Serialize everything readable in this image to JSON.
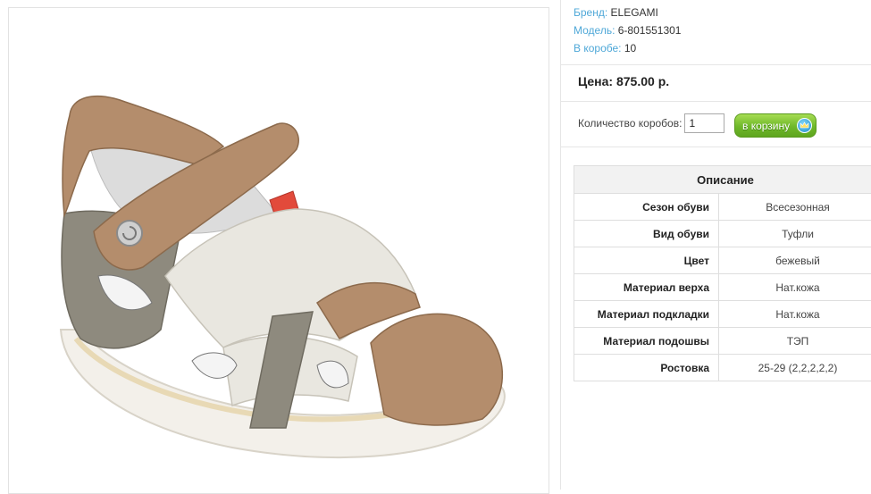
{
  "product": {
    "image_alt": "Детская сандалия ELEGAMI",
    "brand_label": "Бренд:",
    "brand": "ELEGAMI",
    "model_label": "Модель:",
    "model": "6-801551301",
    "box_label": "В коробе:",
    "box_count": "10",
    "price": "Цена: 875.00 р.",
    "qty_label": "Количество коробов:",
    "qty_value": "1",
    "cart_label": "в корзину"
  },
  "specs": {
    "title": "Описание",
    "rows": [
      {
        "key": "Сезон обуви",
        "value": "Всесезонная"
      },
      {
        "key": "Вид обуви",
        "value": "Туфли"
      },
      {
        "key": "Цвет",
        "value": "бежевый"
      },
      {
        "key": "Материал верха",
        "value": "Нат.кожа"
      },
      {
        "key": "Материал подкладки",
        "value": "Нат.кожа"
      },
      {
        "key": "Материал подошвы",
        "value": "ТЭП"
      },
      {
        "key": "Ростовка",
        "value": "25-29 (2,2,2,2,2)"
      }
    ]
  },
  "colors": {
    "link_blue": "#4fa8d8",
    "button_green": "#6fb82a",
    "leather_tan": "#b48d6c",
    "leather_grey": "#8e8a7e",
    "leather_white": "#e9e7e0"
  },
  "icons": {
    "cart_icon": "crown-cart-icon"
  }
}
